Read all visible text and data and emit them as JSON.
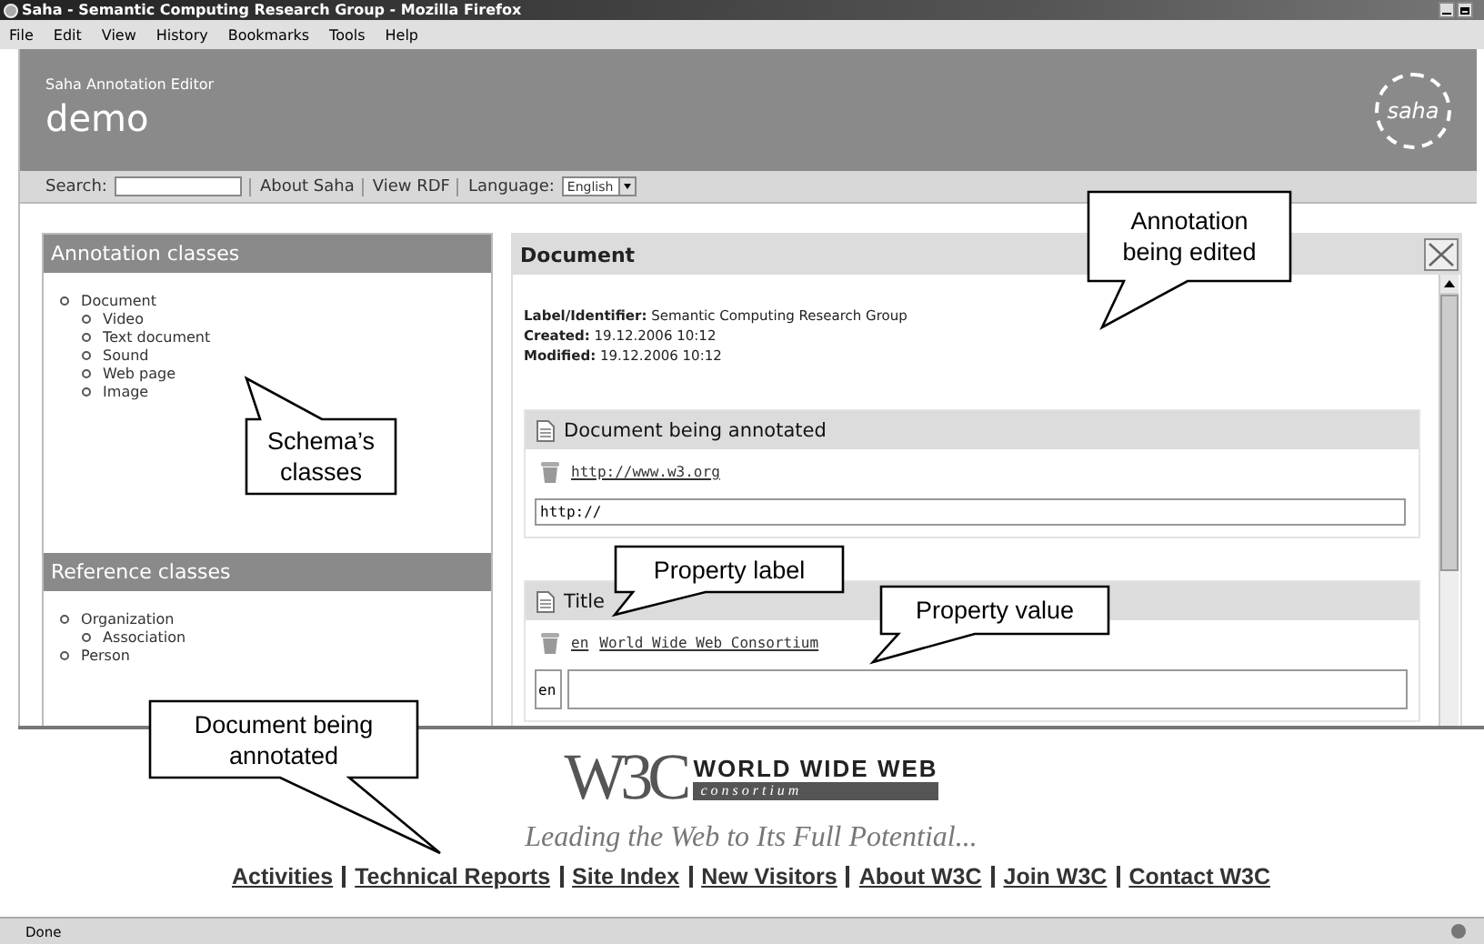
{
  "window": {
    "title": "Saha - Semantic Computing Research Group - Mozilla Firefox"
  },
  "menu": [
    "File",
    "Edit",
    "View",
    "History",
    "Bookmarks",
    "Tools",
    "Help"
  ],
  "header": {
    "subtitle": "Saha Annotation Editor",
    "title": "demo",
    "logo": "saha"
  },
  "toolbar": {
    "search_label": "Search:",
    "links": [
      "About Saha",
      "View RDF"
    ],
    "language_label": "Language:",
    "language_value": "English"
  },
  "annotation_classes": {
    "title": "Annotation classes",
    "items": [
      {
        "label": "Document",
        "children": [
          {
            "label": "Video"
          },
          {
            "label": "Text document"
          },
          {
            "label": "Sound"
          },
          {
            "label": "Web page"
          },
          {
            "label": "Image"
          }
        ]
      }
    ]
  },
  "reference_classes": {
    "title": "Reference classes",
    "items": [
      {
        "label": "Organization",
        "children": [
          {
            "label": "Association"
          }
        ]
      },
      {
        "label": "Person"
      }
    ]
  },
  "editor": {
    "title": "Document",
    "meta": [
      {
        "label": "Label/Identifier:",
        "value": "Semantic Computing Research Group"
      },
      {
        "label": "Created:",
        "value": "19.12.2006 10:12"
      },
      {
        "label": "Modified:",
        "value": "19.12.2006 10:12"
      }
    ],
    "properties": [
      {
        "title": "Document being annotated",
        "values": [
          {
            "text": "http://www.w3.org"
          }
        ],
        "input": "http://"
      },
      {
        "title": "Title",
        "values": [
          {
            "lang": "en",
            "text": "World Wide Web Consortium"
          }
        ],
        "input_lang": "en"
      }
    ]
  },
  "page": {
    "logo_mark": "W3C",
    "logo_title": "WORLD WIDE WEB",
    "logo_subtitle": "c o n s o r t i u m",
    "tagline": "Leading the Web to Its Full Potential...",
    "links": [
      "Activities",
      "Technical Reports",
      "Site Index",
      "New Visitors",
      "About W3C",
      "Join W3C",
      "Contact W3C"
    ]
  },
  "status_bar": {
    "text": "Done"
  },
  "callouts": [
    {
      "text": "Annotation being edited"
    },
    {
      "text": "Schema’s classes"
    },
    {
      "text": "Property label"
    },
    {
      "text": "Property value"
    },
    {
      "text": "Document being annotated"
    }
  ]
}
